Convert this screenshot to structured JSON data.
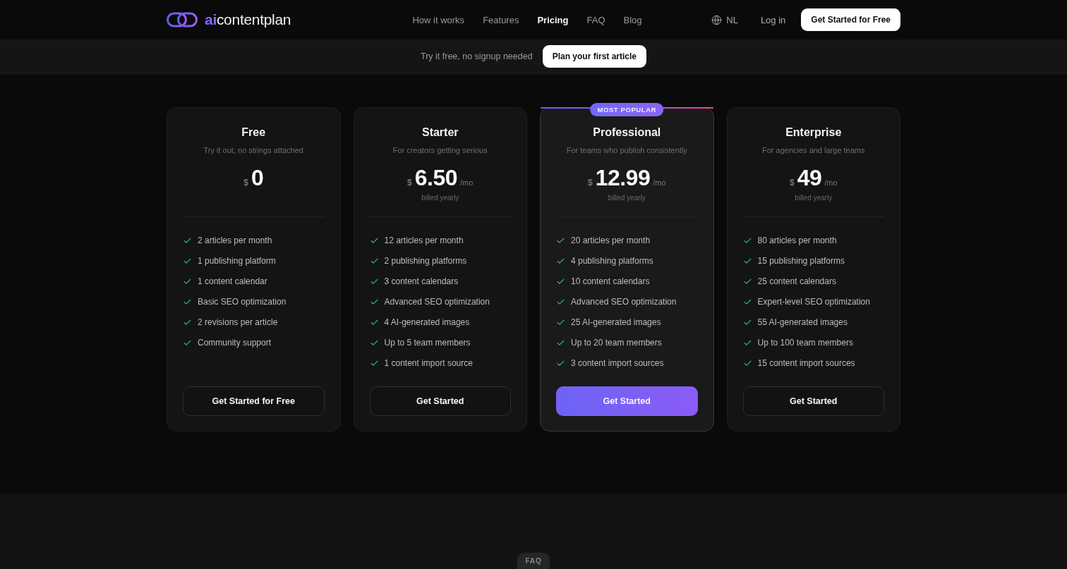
{
  "header": {
    "logo": "**ai**contentplan",
    "nav": [
      {
        "label": "How it works",
        "selected": false
      },
      {
        "label": "Features",
        "selected": false
      },
      {
        "label": "Pricing",
        "selected": true
      },
      {
        "label": "FAQ",
        "selected": false
      },
      {
        "label": "Blog",
        "selected": false
      }
    ],
    "language": "NL",
    "login": "Log in",
    "cta": "Get Started for Free"
  },
  "promo": {
    "text": "Try it free, no signup needed",
    "button": "Plan your first article"
  },
  "plans": [
    {
      "name": "Free",
      "tagline": "Try it out, no strings attached",
      "currency": "$",
      "amount": "0",
      "highlighted": false,
      "features": [
        "2 articles per month",
        "1 publishing platform",
        "1 content calendar",
        "Basic SEO optimization",
        "2 revisions per article",
        "Community support"
      ],
      "button": "Get Started for Free"
    },
    {
      "name": "Starter",
      "tagline": "For creators getting serious",
      "currency": "$",
      "amount": "6.50",
      "period": "/mo",
      "billing": "billed yearly",
      "highlighted": false,
      "features": [
        "12 articles per month",
        "2 publishing platforms",
        "3 content calendars",
        "Advanced SEO optimization",
        "4 AI-generated images",
        "Up to 5 team members",
        "1 content import source"
      ],
      "button": "Get Started"
    },
    {
      "name": "Professional",
      "badge": "MOST POPULAR",
      "tagline": "For teams who publish consistently",
      "currency": "$",
      "amount": "12.99",
      "period": "/mo",
      "billing": "billed yearly",
      "highlighted": true,
      "features": [
        "20 articles per month",
        "4 publishing platforms",
        "10 content calendars",
        "Advanced SEO optimization",
        "25 AI-generated images",
        "Up to 20 team members",
        "3 content import sources"
      ],
      "button": "Get Started"
    },
    {
      "name": "Enterprise",
      "tagline": "For agencies and large teams",
      "currency": "$",
      "amount": "49",
      "period": "/mo",
      "billing": "billed yearly",
      "highlighted": false,
      "features": [
        "80 articles per month",
        "15 publishing platforms",
        "25 content calendars",
        "Expert-level SEO optimization",
        "55 AI-generated images",
        "Up to 100 team members",
        "15 content import sources"
      ],
      "button": "Get Started"
    }
  ],
  "next_section": {
    "badge": "FAQ"
  }
}
